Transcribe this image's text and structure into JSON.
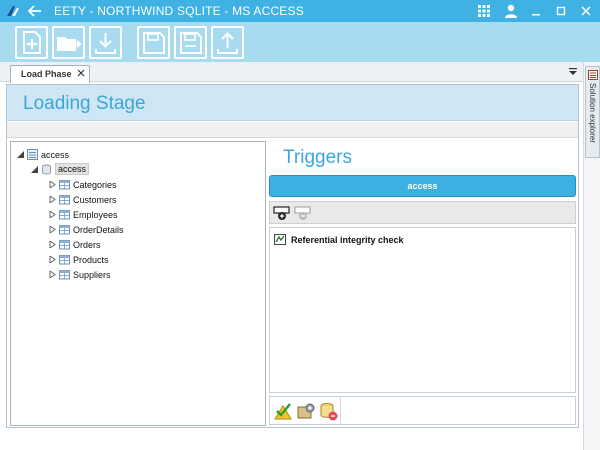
{
  "window": {
    "title": "EETY - NORTHWIND SQLITE - MS ACCESS"
  },
  "titlebar_icons": [
    "app-logo-icon",
    "back-arrow-icon",
    "grid-apps-icon",
    "user-icon",
    "minimize-icon",
    "maximize-icon",
    "close-icon"
  ],
  "toolbar": {
    "buttons": [
      "new-document-icon",
      "open-folder-icon",
      "download-icon",
      "save-icon",
      "save-all-icon",
      "upload-icon"
    ]
  },
  "tabs": [
    {
      "label": "Load Phase",
      "active": true
    }
  ],
  "sidebar_right": {
    "label": "Solution explorer"
  },
  "stage": {
    "title": "Loading Stage"
  },
  "tree": {
    "root": {
      "label": "access"
    },
    "database": {
      "label": "access"
    },
    "tables": [
      {
        "label": "Categories"
      },
      {
        "label": "Customers"
      },
      {
        "label": "Employees"
      },
      {
        "label": "OrderDetails"
      },
      {
        "label": "Orders"
      },
      {
        "label": "Products"
      },
      {
        "label": "Suppliers"
      }
    ]
  },
  "triggers": {
    "title": "Triggers",
    "selected_db": "access",
    "items": [
      {
        "label": "Referential integrity check"
      }
    ]
  },
  "colors": {
    "titlebar": "#3fb1e2",
    "toolbar": "#a8dbef",
    "accent_text": "#3ba7d8",
    "header_band": "#cfe6f5"
  }
}
